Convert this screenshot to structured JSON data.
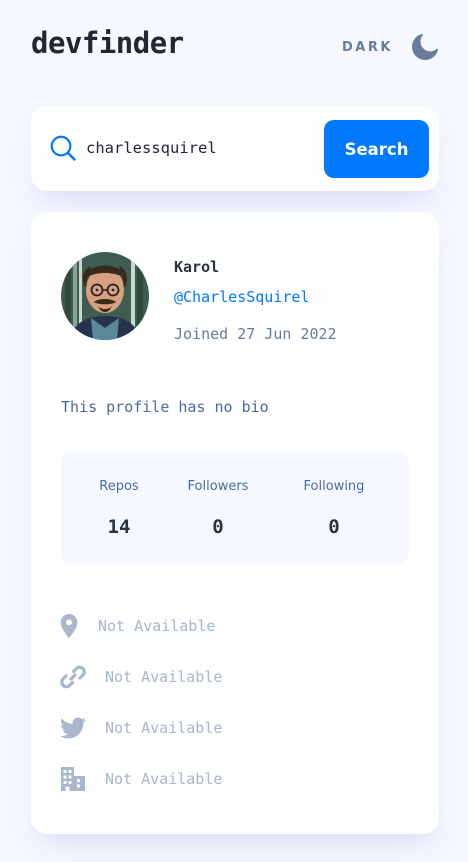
{
  "header": {
    "logo": "devfinder",
    "theme_label": "DARK",
    "theme_icon": "moon-icon"
  },
  "search": {
    "icon": "search-icon",
    "value": "charlessquirel",
    "placeholder": "",
    "button_label": "Search"
  },
  "profile": {
    "name": "Karol",
    "login": "@CharlesSquirel",
    "joined": "Joined 27 Jun 2022",
    "bio": "This profile has no bio",
    "stats": [
      {
        "label": "Repos",
        "value": "14"
      },
      {
        "label": "Followers",
        "value": "0"
      },
      {
        "label": "Following",
        "value": "0"
      }
    ],
    "links": [
      {
        "icon": "location-icon",
        "text": "Not Available"
      },
      {
        "icon": "link-icon",
        "text": "Not Available"
      },
      {
        "icon": "twitter-icon",
        "text": "Not Available"
      },
      {
        "icon": "company-icon",
        "text": "Not Available"
      }
    ]
  },
  "colors": {
    "accent": "#0079ff",
    "background": "#f6f8ff",
    "card": "#fefefe",
    "text_dark": "#2b3442",
    "text_muted": "#697c9a",
    "text_blue_grey": "#4b6a9b",
    "unavailable": "#a9b6cc"
  }
}
